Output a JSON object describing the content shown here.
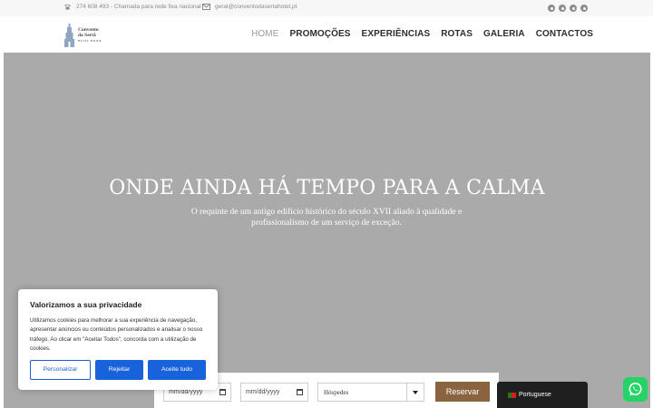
{
  "topbar": {
    "phone_text": "274 608 493 - Chamada para rede fixa nacional",
    "email_text": "geral@conventodasertahotel.pt",
    "social_icons": [
      "facebook-icon",
      "instagram-icon",
      "pinterest-icon",
      "tripadvisor-icon"
    ]
  },
  "logo": {
    "line1": "Convento",
    "line2": "da Sertã",
    "line3": "HOTEL ★★★★"
  },
  "nav": {
    "items": [
      "HOME",
      "PROMOÇÕES",
      "EXPERIÊNCIAS",
      "ROTAS",
      "GALERIA",
      "CONTACTOS"
    ],
    "active": "HOME"
  },
  "hero": {
    "title": "ONDE AINDA HÁ TEMPO PARA A CALMA",
    "subtitle": "O requinte de um antigo edifício histórico do século XVII aliado à qualidade e profissionalismo de um serviço de exceção."
  },
  "booking": {
    "checkin_placeholder": "mm/dd/yyyy",
    "checkout_placeholder": "mm/dd/yyyy",
    "guests_label": "Hóspedes",
    "reserve_label": "Reservar"
  },
  "cookie": {
    "title": "Valorizamos a sua privacidade",
    "text": "Utilizamos cookies para melhorar a sua experiência de navegação, apresentar anúncios ou conteúdos personalizados e analisar o nosso tráfego. Ao clicar em \"Aceitar Todos\", concorda com a utilização de cookies.",
    "customize_label": "Personalizar",
    "reject_label": "Rejeitar",
    "accept_label": "Aceite tudo"
  },
  "language": {
    "label": "Portuguese"
  },
  "colors": {
    "hero_bg": "#aaaaaa",
    "accent_brown": "#8a633f",
    "cookie_blue": "#1863dc",
    "whatsapp_green": "#25d366"
  }
}
